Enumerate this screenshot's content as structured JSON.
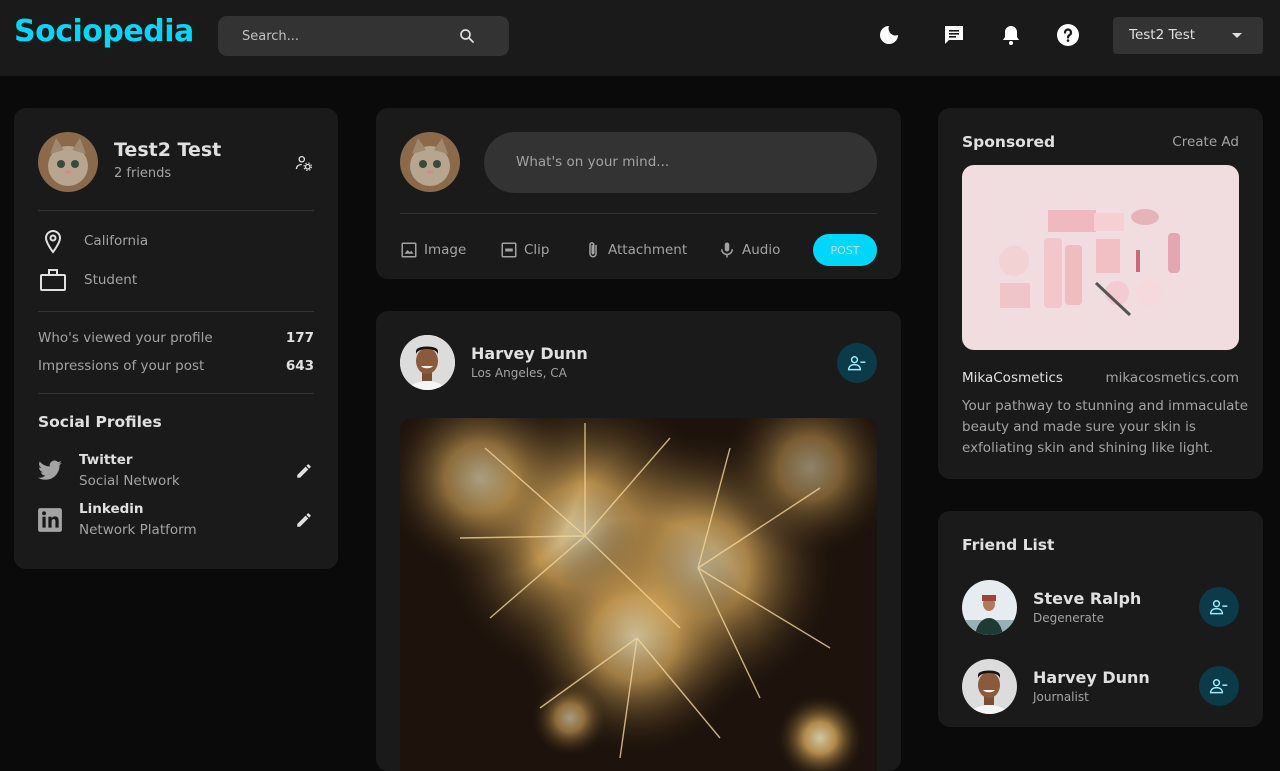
{
  "app": {
    "title": "Sociopedia"
  },
  "colors": {
    "accent": "#00d5fa",
    "card": "#1a1a1a",
    "page": "#0a0a0a",
    "friend_btn": "#0b3a48"
  },
  "navbar": {
    "search_placeholder": "Search...",
    "icons": [
      "moon-icon",
      "message-icon",
      "bell-icon",
      "help-icon"
    ],
    "user_name": "Test2 Test"
  },
  "profile": {
    "name": "Test2 Test",
    "friends": "2 friends",
    "location": "California",
    "occupation": "Student",
    "stats": [
      {
        "label": "Who's viewed your profile",
        "value": "177"
      },
      {
        "label": "Impressions of your post",
        "value": "643"
      }
    ],
    "social_title": "Social Profiles",
    "socials": [
      {
        "name": "Twitter",
        "desc": "Social Network"
      },
      {
        "name": "Linkedin",
        "desc": "Network Platform"
      }
    ]
  },
  "composer": {
    "placeholder": "What's on your mind...",
    "actions": [
      "Image",
      "Clip",
      "Attachment",
      "Audio"
    ],
    "post_label": "POST"
  },
  "post": {
    "author": "Harvey Dunn",
    "location": "Los Angeles, CA"
  },
  "sponsored": {
    "title": "Sponsored",
    "create_ad": "Create Ad",
    "brand": "MikaCosmetics",
    "url": "mikacosmetics.com",
    "desc_lines": [
      "Your pathway to stunning and immaculate",
      "beauty and made sure your skin is",
      "exfoliating skin and shining like light."
    ]
  },
  "friend_list": {
    "title": "Friend List",
    "friends": [
      {
        "name": "Steve Ralph",
        "role": "Degenerate"
      },
      {
        "name": "Harvey Dunn",
        "role": "Journalist"
      }
    ]
  }
}
